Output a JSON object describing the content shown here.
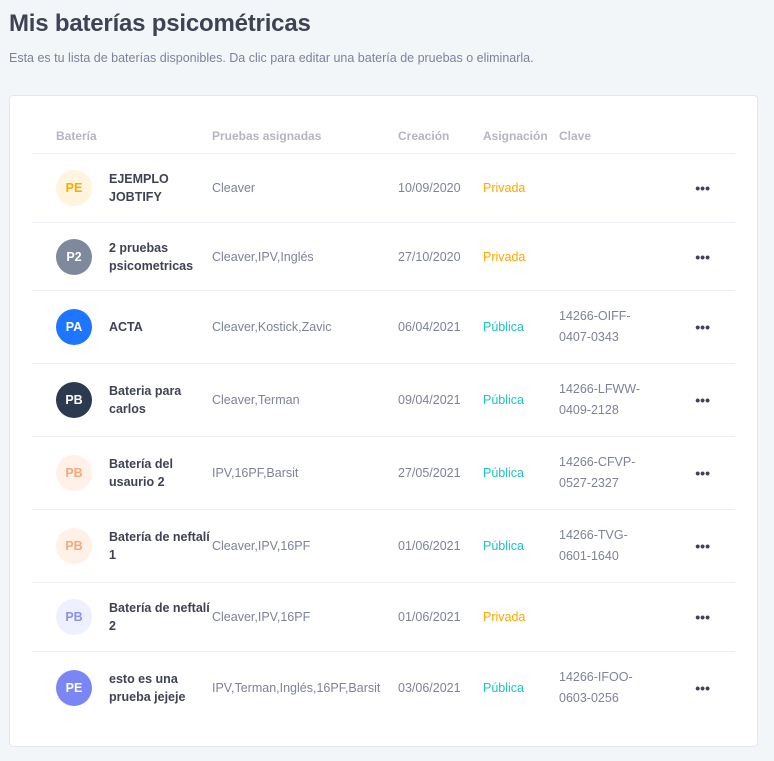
{
  "page": {
    "title": "Mis baterías psicométricas",
    "subtitle": "Esta es tu lista de baterías disponibles. Da clic para editar una batería de pruebas o eliminarla."
  },
  "table": {
    "headers": {
      "name": "Batería",
      "tests": "Pruebas asignadas",
      "date": "Creación",
      "assign": "Asignación",
      "key": "Clave"
    },
    "rows": [
      {
        "initials": "PE",
        "name": "EJEMPLO JOBTIFY",
        "tests": "Cleaver",
        "date": "10/09/2020",
        "assign": "Privada",
        "key1": "",
        "key2": "",
        "avatar_bg": "#fff4de",
        "avatar_fg": "#ffa800",
        "assign_color": "#ffa800"
      },
      {
        "initials": "P2",
        "name": "2 pruebas psicometricas",
        "tests": "Cleaver,IPV,Inglés",
        "date": "27/10/2020",
        "assign": "Privada",
        "key1": "",
        "key2": "",
        "avatar_bg": "#7e8a9b",
        "avatar_fg": "#ffffff",
        "assign_color": "#ffa800"
      },
      {
        "initials": "PA",
        "name": "ACTA",
        "tests": "Cleaver,Kostick,Zavic",
        "date": "06/04/2021",
        "assign": "Pública",
        "key1": "14266-OIFF-",
        "key2": "0407-0343",
        "avatar_bg": "#1e76ff",
        "avatar_fg": "#ffffff",
        "assign_color": "#1bc5bd"
      },
      {
        "initials": "PB",
        "name": "Bateria para carlos",
        "tests": "Cleaver,Terman",
        "date": "09/04/2021",
        "assign": "Pública",
        "key1": "14266-LFWW-",
        "key2": "0409-2128",
        "avatar_bg": "#2b3a4e",
        "avatar_fg": "#ffffff",
        "assign_color": "#1bc5bd"
      },
      {
        "initials": "PB",
        "name": "Batería del usaurio 2",
        "tests": "IPV,16PF,Barsit",
        "date": "27/05/2021",
        "assign": "Pública",
        "key1": "14266-CFVP-",
        "key2": "0527-2327",
        "avatar_bg": "#fff1e8",
        "avatar_fg": "#f5a87a",
        "assign_color": "#1bc5bd"
      },
      {
        "initials": "PB",
        "name": "Batería de neftalí 1",
        "tests": "Cleaver,IPV,16PF",
        "date": "01/06/2021",
        "assign": "Pública",
        "key1": "14266-TVG-",
        "key2": "0601-1640",
        "avatar_bg": "#fff1e8",
        "avatar_fg": "#f5a87a",
        "assign_color": "#1bc5bd"
      },
      {
        "initials": "PB",
        "name": "Batería de neftalí 2",
        "tests": "Cleaver,IPV,16PF",
        "date": "01/06/2021",
        "assign": "Privada",
        "key1": "",
        "key2": "",
        "avatar_bg": "#eef0ff",
        "avatar_fg": "#8a93e8",
        "assign_color": "#ffa800"
      },
      {
        "initials": "PE",
        "name": "esto es una prueba jejeje",
        "tests": "IPV,Terman,Inglés,16PF,Barsit",
        "date": "03/06/2021",
        "assign": "Pública",
        "key1": "14266-IFOO-",
        "key2": "0603-0256",
        "avatar_bg": "#7b86f5",
        "avatar_fg": "#ffffff",
        "assign_color": "#1bc5bd"
      }
    ]
  },
  "icons": {
    "row_actions": "more-horizontal-icon"
  },
  "actions_label": "•••"
}
